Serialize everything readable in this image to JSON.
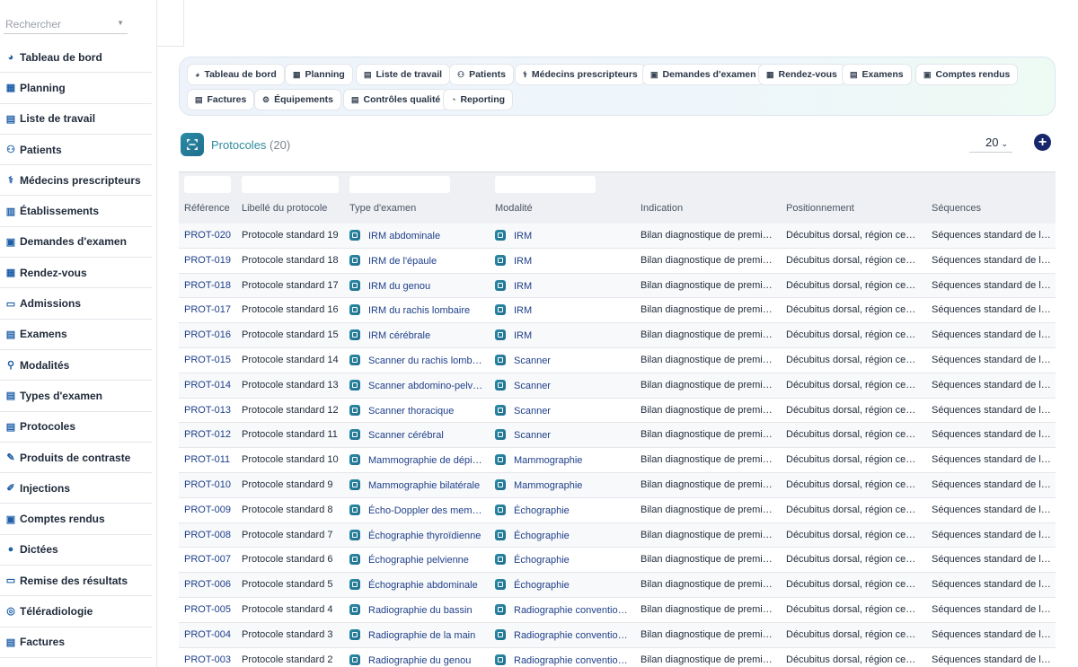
{
  "search": {
    "placeholder": "Rechercher"
  },
  "sidebar": {
    "items": [
      {
        "label": "Tableau de bord",
        "icon": "gauge-icon"
      },
      {
        "label": "Planning",
        "icon": "calendar-icon"
      },
      {
        "label": "Liste de travail",
        "icon": "worklist-icon"
      },
      {
        "label": "Patients",
        "icon": "users-icon"
      },
      {
        "label": "Médecins prescripteurs",
        "icon": "doctor-icon"
      },
      {
        "label": "Établissements",
        "icon": "building-icon"
      },
      {
        "label": "Demandes d'examen",
        "icon": "file-plus-icon"
      },
      {
        "label": "Rendez-vous",
        "icon": "calendar-check-icon"
      },
      {
        "label": "Admissions",
        "icon": "id-card-icon"
      },
      {
        "label": "Examens",
        "icon": "worklist-icon"
      },
      {
        "label": "Modalités",
        "icon": "microscope-icon"
      },
      {
        "label": "Types d'examen",
        "icon": "clipboard-icon"
      },
      {
        "label": "Protocoles",
        "icon": "clipboard-list-icon"
      },
      {
        "label": "Produits de contraste",
        "icon": "eyedropper-icon"
      },
      {
        "label": "Injections",
        "icon": "syringe-icon"
      },
      {
        "label": "Comptes rendus",
        "icon": "file-medical-icon"
      },
      {
        "label": "Dictées",
        "icon": "microphone-icon"
      },
      {
        "label": "Remise des résultats",
        "icon": "printer-icon"
      },
      {
        "label": "Téléradiologie",
        "icon": "broadcast-icon"
      },
      {
        "label": "Factures",
        "icon": "invoice-icon"
      }
    ]
  },
  "quick_links": [
    {
      "label": "Tableau de bord",
      "icon": "gauge-icon"
    },
    {
      "label": "Planning",
      "icon": "calendar-icon"
    },
    {
      "label": "Liste de travail",
      "icon": "worklist-icon"
    },
    {
      "label": "Patients",
      "icon": "users-icon"
    },
    {
      "label": "Médecins prescripteurs",
      "icon": "doctor-icon"
    },
    {
      "label": "Demandes d'examen",
      "icon": "file-plus-icon"
    },
    {
      "label": "Rendez-vous",
      "icon": "calendar-check-icon"
    },
    {
      "label": "Examens",
      "icon": "worklist-icon"
    },
    {
      "label": "Comptes rendus",
      "icon": "file-medical-icon"
    },
    {
      "label": "Factures",
      "icon": "invoice-icon"
    },
    {
      "label": "Équipements",
      "icon": "gears-icon"
    },
    {
      "label": "Contrôles qualité",
      "icon": "clipboard-check-icon"
    },
    {
      "label": "Reporting",
      "icon": "chart-pie-icon"
    }
  ],
  "header": {
    "title": "Protocoles",
    "count": "(20)",
    "page_size": "20"
  },
  "table": {
    "columns": [
      "Référence",
      "Libellé du protocole",
      "Type d'examen",
      "Modalité",
      "Indication",
      "Positionnement",
      "Séquences"
    ],
    "rows": [
      [
        "PROT-020",
        "Protocole standard 19",
        "IRM abdominale",
        "IRM",
        "Bilan diagnostique de premi…",
        "Décubitus dorsal, région ce…",
        "Séquences standard de la …"
      ],
      [
        "PROT-019",
        "Protocole standard 18",
        "IRM de l'épaule",
        "IRM",
        "Bilan diagnostique de premi…",
        "Décubitus dorsal, région ce…",
        "Séquences standard de la …"
      ],
      [
        "PROT-018",
        "Protocole standard 17",
        "IRM du genou",
        "IRM",
        "Bilan diagnostique de premi…",
        "Décubitus dorsal, région ce…",
        "Séquences standard de la …"
      ],
      [
        "PROT-017",
        "Protocole standard 16",
        "IRM du rachis lombaire",
        "IRM",
        "Bilan diagnostique de premi…",
        "Décubitus dorsal, région ce…",
        "Séquences standard de la …"
      ],
      [
        "PROT-016",
        "Protocole standard 15",
        "IRM cérébrale",
        "IRM",
        "Bilan diagnostique de premi…",
        "Décubitus dorsal, région ce…",
        "Séquences standard de la …"
      ],
      [
        "PROT-015",
        "Protocole standard 14",
        "Scanner du rachis lomb…",
        "Scanner",
        "Bilan diagnostique de premi…",
        "Décubitus dorsal, région ce…",
        "Séquences standard de la …"
      ],
      [
        "PROT-014",
        "Protocole standard 13",
        "Scanner abdomino-pelv…",
        "Scanner",
        "Bilan diagnostique de premi…",
        "Décubitus dorsal, région ce…",
        "Séquences standard de la …"
      ],
      [
        "PROT-013",
        "Protocole standard 12",
        "Scanner thoracique",
        "Scanner",
        "Bilan diagnostique de premi…",
        "Décubitus dorsal, région ce…",
        "Séquences standard de la …"
      ],
      [
        "PROT-012",
        "Protocole standard 11",
        "Scanner cérébral",
        "Scanner",
        "Bilan diagnostique de premi…",
        "Décubitus dorsal, région ce…",
        "Séquences standard de la …"
      ],
      [
        "PROT-011",
        "Protocole standard 10",
        "Mammographie de dépi…",
        "Mammographie",
        "Bilan diagnostique de premi…",
        "Décubitus dorsal, région ce…",
        "Séquences standard de la …"
      ],
      [
        "PROT-010",
        "Protocole standard 9",
        "Mammographie bilatérale",
        "Mammographie",
        "Bilan diagnostique de premi…",
        "Décubitus dorsal, région ce…",
        "Séquences standard de la …"
      ],
      [
        "PROT-009",
        "Protocole standard 8",
        "Écho-Doppler des mem…",
        "Échographie",
        "Bilan diagnostique de premi…",
        "Décubitus dorsal, région ce…",
        "Séquences standard de la …"
      ],
      [
        "PROT-008",
        "Protocole standard 7",
        "Échographie thyroïdienne",
        "Échographie",
        "Bilan diagnostique de premi…",
        "Décubitus dorsal, région ce…",
        "Séquences standard de la …"
      ],
      [
        "PROT-007",
        "Protocole standard 6",
        "Échographie pelvienne",
        "Échographie",
        "Bilan diagnostique de premi…",
        "Décubitus dorsal, région ce…",
        "Séquences standard de la …"
      ],
      [
        "PROT-006",
        "Protocole standard 5",
        "Échographie abdominale",
        "Échographie",
        "Bilan diagnostique de premi…",
        "Décubitus dorsal, région ce…",
        "Séquences standard de la …"
      ],
      [
        "PROT-005",
        "Protocole standard 4",
        "Radiographie du bassin",
        "Radiographie conventio…",
        "Bilan diagnostique de premi…",
        "Décubitus dorsal, région ce…",
        "Séquences standard de la …"
      ],
      [
        "PROT-004",
        "Protocole standard 3",
        "Radiographie de la main",
        "Radiographie conventio…",
        "Bilan diagnostique de premi…",
        "Décubitus dorsal, région ce…",
        "Séquences standard de la …"
      ],
      [
        "PROT-003",
        "Protocole standard 2",
        "Radiographie du genou",
        "Radiographie conventio…",
        "Bilan diagnostique de premi…",
        "Décubitus dorsal, région ce…",
        "Séquences standard de la …"
      ]
    ]
  },
  "colors": {
    "accent": "#2e8c9c",
    "link": "#1e3f8a",
    "add_button": "#18276b"
  }
}
